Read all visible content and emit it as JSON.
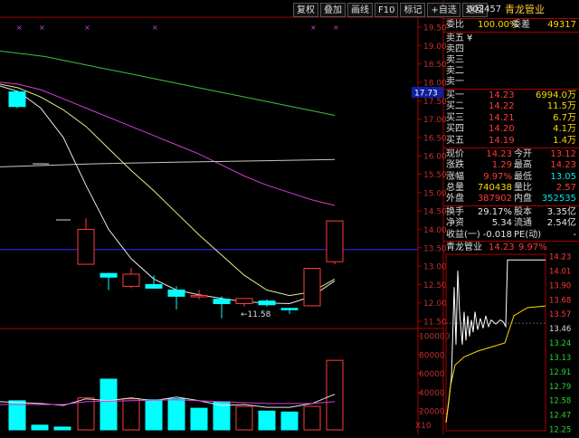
{
  "toolbar": {
    "buttons": [
      "复权",
      "叠加",
      "画线",
      "F10",
      "标记",
      "+自选",
      "返回"
    ]
  },
  "stock": {
    "code": "002457",
    "name": "青龙管业"
  },
  "orderbook": {
    "wei_bi_label": "委比",
    "wei_bi_value": "100.00%",
    "wei_cha_label": "委差",
    "wei_cha_value": "49317",
    "sells": [
      {
        "label": "卖五",
        "price": "¥",
        "vol": ""
      },
      {
        "label": "卖四",
        "price": "",
        "vol": ""
      },
      {
        "label": "卖三",
        "price": "",
        "vol": ""
      },
      {
        "label": "卖二",
        "price": "",
        "vol": ""
      },
      {
        "label": "卖一",
        "price": "",
        "vol": ""
      }
    ],
    "buys": [
      {
        "label": "买一",
        "price": "14.23",
        "vol": "6994.0万"
      },
      {
        "label": "买二",
        "price": "14.22",
        "vol": "11.5万"
      },
      {
        "label": "买三",
        "price": "14.21",
        "vol": "6.7万"
      },
      {
        "label": "买四",
        "price": "14.20",
        "vol": "4.1万"
      },
      {
        "label": "买五",
        "price": "14.19",
        "vol": "1.4万"
      }
    ]
  },
  "quote": [
    {
      "l1": "现价",
      "v1": "14.23",
      "l2": "今开",
      "v2": "13.12"
    },
    {
      "l1": "涨跌",
      "v1": "1.29",
      "l2": "最高",
      "v2": "14.23"
    },
    {
      "l1": "涨幅",
      "v1": "9.97%",
      "l2": "最低",
      "v2": "13.05"
    },
    {
      "l1": "总量",
      "v1": "740438",
      "l2": "量比",
      "v2": "2.57"
    },
    {
      "l1": "外盘",
      "v1": "387902",
      "l2": "内盘",
      "v2": "352535"
    }
  ],
  "fundamentals": [
    {
      "l1": "换手",
      "v1": "29.17%",
      "l2": "股本",
      "v2": "3.35亿"
    },
    {
      "l1": "净资",
      "v1": "5.34",
      "l2": "流通",
      "v2": "2.54亿"
    },
    {
      "l1": "收益(一)",
      "v1": "-0.018",
      "l2": "PE(动)",
      "v2": "-"
    }
  ],
  "mini_chart": {
    "title_name": "青龙管业",
    "title_price": "14.23",
    "title_pct": "9.97%",
    "y_labels": [
      "14.23",
      "14.01",
      "13.90",
      "13.68",
      "13.57",
      "13.46",
      "13.24",
      "13.13",
      "12.91",
      "12.79",
      "12.58",
      "12.47",
      "12.25"
    ]
  },
  "main_chart": {
    "y_axis_labels": [
      "19.50",
      "19.00",
      "18.50",
      "18.00",
      "17.50",
      "17.00",
      "16.50",
      "16.00",
      "15.50",
      "15.00",
      "14.50",
      "14.00",
      "13.50",
      "13.00",
      "12.50",
      "12.00",
      "11.50"
    ],
    "price_marker": "17.73",
    "low_label": "11.58",
    "volume_axis_labels": [
      "100000",
      "80000",
      "60000",
      "40000",
      "20000"
    ],
    "volume_unit": "X10"
  },
  "chart_data": {
    "type": "candlestick",
    "y_range": [
      11.3,
      19.7
    ],
    "candles": [
      {
        "o": 17.74,
        "c": 17.34,
        "h": 17.74,
        "l": 17.3
      },
      {
        "o": 13.05,
        "c": 14.0,
        "h": 14.3,
        "l": 13.05
      },
      {
        "o": 12.8,
        "c": 12.7,
        "h": 12.82,
        "l": 12.35
      },
      {
        "o": 12.45,
        "c": 12.78,
        "h": 12.95,
        "l": 12.4
      },
      {
        "o": 12.5,
        "c": 12.4,
        "h": 12.75,
        "l": 12.38
      },
      {
        "o": 12.35,
        "c": 12.18,
        "h": 12.45,
        "l": 11.82
      },
      {
        "o": 12.2,
        "c": 12.2,
        "h": 12.35,
        "l": 12.1
      },
      {
        "o": 12.1,
        "c": 11.98,
        "h": 12.18,
        "l": 11.58
      },
      {
        "o": 11.98,
        "c": 12.12,
        "h": 12.12,
        "l": 11.9
      },
      {
        "o": 12.05,
        "c": 11.95,
        "h": 12.1,
        "l": 11.9
      },
      {
        "o": 11.85,
        "c": 11.82,
        "h": 11.87,
        "l": 11.7
      },
      {
        "o": 11.92,
        "c": 12.94,
        "h": 12.94,
        "l": 11.9
      },
      {
        "o": 13.12,
        "c": 14.23,
        "h": 14.23,
        "l": 13.05
      }
    ],
    "candle_x": [
      19,
      95,
      120,
      145,
      170,
      195,
      220,
      245,
      270,
      295,
      320,
      345,
      370
    ],
    "volumes": [
      0,
      45000,
      0,
      5000,
      3000,
      52000,
      3200,
      3300,
      3300,
      2300,
      2200,
      1900,
      2500,
      7400
    ],
    "volume_slots": [
      -1,
      19,
      44,
      69,
      95,
      120,
      145,
      170,
      195,
      220,
      245,
      270,
      295,
      320,
      345,
      370
    ],
    "vol_bars": [
      {
        "x": 19,
        "v": 31000,
        "up": false
      },
      {
        "x": 44,
        "v": 5000,
        "up": false
      },
      {
        "x": 69,
        "v": 3000,
        "up": false
      },
      {
        "x": 95,
        "v": 34000,
        "up": true
      },
      {
        "x": 120,
        "v": 54000,
        "up": false
      },
      {
        "x": 145,
        "v": 33000,
        "up": true
      },
      {
        "x": 170,
        "v": 32000,
        "up": false
      },
      {
        "x": 195,
        "v": 33000,
        "up": false
      },
      {
        "x": 220,
        "v": 23000,
        "up": false
      },
      {
        "x": 245,
        "v": 30000,
        "up": false
      },
      {
        "x": 270,
        "v": 25000,
        "up": true
      },
      {
        "x": 295,
        "v": 20000,
        "up": false
      },
      {
        "x": 320,
        "v": 19000,
        "up": false
      },
      {
        "x": 345,
        "v": 25000,
        "up": true
      },
      {
        "x": 370,
        "v": 74000,
        "up": true
      }
    ],
    "vol_range": [
      0,
      105000
    ],
    "ma_lines": [
      {
        "name": "MA5",
        "color": "#e8e8e8",
        "points": [
          [
            0,
            17.9
          ],
          [
            20,
            17.75
          ],
          [
            45,
            17.3
          ],
          [
            70,
            16.5
          ],
          [
            95,
            15.2
          ],
          [
            120,
            14.0
          ],
          [
            145,
            13.2
          ],
          [
            170,
            12.65
          ],
          [
            195,
            12.35
          ],
          [
            220,
            12.22
          ],
          [
            245,
            12.12
          ],
          [
            270,
            12.03
          ],
          [
            295,
            12.0
          ],
          [
            320,
            11.98
          ],
          [
            345,
            12.18
          ],
          [
            370,
            12.6
          ]
        ]
      },
      {
        "name": "MA10",
        "color": "#e8e890",
        "points": [
          [
            0,
            17.95
          ],
          [
            20,
            17.85
          ],
          [
            45,
            17.6
          ],
          [
            70,
            17.25
          ],
          [
            95,
            16.8
          ],
          [
            120,
            16.2
          ],
          [
            145,
            15.6
          ],
          [
            170,
            15.05
          ],
          [
            195,
            14.45
          ],
          [
            220,
            13.85
          ],
          [
            245,
            13.3
          ],
          [
            270,
            12.75
          ],
          [
            295,
            12.35
          ],
          [
            320,
            12.2
          ],
          [
            345,
            12.3
          ],
          [
            370,
            12.65
          ]
        ]
      },
      {
        "name": "MA20",
        "color": "#d040d0",
        "points": [
          [
            0,
            18.0
          ],
          [
            20,
            17.95
          ],
          [
            45,
            17.8
          ],
          [
            70,
            17.55
          ],
          [
            95,
            17.3
          ],
          [
            120,
            17.05
          ],
          [
            145,
            16.8
          ],
          [
            170,
            16.55
          ],
          [
            195,
            16.3
          ],
          [
            220,
            16.05
          ],
          [
            245,
            15.75
          ],
          [
            270,
            15.45
          ],
          [
            295,
            15.2
          ],
          [
            320,
            15.0
          ],
          [
            345,
            14.8
          ],
          [
            370,
            14.65
          ]
        ]
      },
      {
        "name": "MA30",
        "color": "#40c040",
        "points": [
          [
            0,
            18.85
          ],
          [
            50,
            18.7
          ],
          [
            100,
            18.45
          ],
          [
            150,
            18.2
          ],
          [
            200,
            17.95
          ],
          [
            250,
            17.7
          ],
          [
            300,
            17.45
          ],
          [
            340,
            17.25
          ],
          [
            370,
            17.1
          ]
        ]
      },
      {
        "name": "MA60",
        "color": "#c8c8c8",
        "points": [
          [
            0,
            15.7
          ],
          [
            100,
            15.78
          ],
          [
            200,
            15.83
          ],
          [
            300,
            15.87
          ],
          [
            370,
            15.9
          ]
        ]
      }
    ],
    "ref_level": 13.45,
    "vol_ma": [
      {
        "color": "#e8e8e8",
        "points": [
          [
            0,
            30000
          ],
          [
            45,
            28000
          ],
          [
            70,
            26000
          ],
          [
            95,
            33000
          ],
          [
            120,
            31000
          ],
          [
            145,
            34000
          ],
          [
            170,
            31000
          ],
          [
            195,
            35000
          ],
          [
            220,
            31000
          ],
          [
            245,
            26000
          ],
          [
            270,
            27000
          ],
          [
            295,
            24000
          ],
          [
            320,
            24000
          ],
          [
            345,
            28000
          ],
          [
            370,
            38000
          ]
        ]
      },
      {
        "color": "#d040d0",
        "points": [
          [
            0,
            27000
          ],
          [
            70,
            27000
          ],
          [
            95,
            30000
          ],
          [
            145,
            31000
          ],
          [
            195,
            32000
          ],
          [
            245,
            30000
          ],
          [
            295,
            28000
          ],
          [
            345,
            28000
          ],
          [
            370,
            30000
          ]
        ]
      }
    ],
    "minute": {
      "range": [
        12.15,
        14.3
      ],
      "price": [
        [
          0,
          12.25
        ],
        [
          3,
          12.5
        ],
        [
          6,
          12.8
        ],
        [
          9,
          13.9
        ],
        [
          11,
          13.2
        ],
        [
          13,
          14.1
        ],
        [
          15,
          13.6
        ],
        [
          18,
          13.2
        ],
        [
          20,
          13.6
        ],
        [
          22,
          13.25
        ],
        [
          24,
          13.55
        ],
        [
          26,
          13.3
        ],
        [
          28,
          13.5
        ],
        [
          30,
          13.35
        ],
        [
          32,
          13.6
        ],
        [
          35,
          13.38
        ],
        [
          38,
          13.52
        ],
        [
          41,
          13.4
        ],
        [
          44,
          13.55
        ],
        [
          47,
          13.42
        ],
        [
          50,
          13.5
        ],
        [
          55,
          13.45
        ],
        [
          60,
          13.5
        ],
        [
          63,
          13.48
        ],
        [
          66,
          13.42
        ],
        [
          68,
          14.23
        ],
        [
          110,
          14.23
        ]
      ],
      "avg": [
        [
          0,
          12.25
        ],
        [
          5,
          12.7
        ],
        [
          10,
          12.95
        ],
        [
          20,
          13.05
        ],
        [
          35,
          13.12
        ],
        [
          50,
          13.17
        ],
        [
          65,
          13.22
        ],
        [
          75,
          13.55
        ],
        [
          90,
          13.65
        ],
        [
          110,
          13.67
        ]
      ]
    }
  }
}
